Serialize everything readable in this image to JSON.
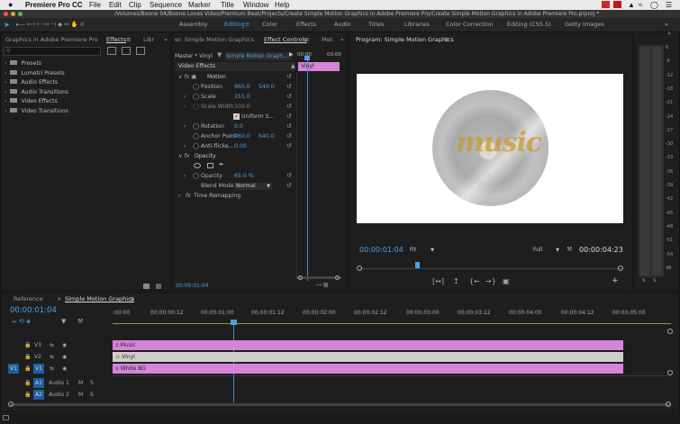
{
  "menubar": {
    "apple": "",
    "app": "Premiere Pro CC",
    "items": [
      "File",
      "Edit",
      "Clip",
      "Sequence",
      "Marker",
      "Title",
      "Window",
      "Help"
    ]
  },
  "titlebar": {
    "path": "/Volumes/Boone 04/Boone Loves Video/Premium Beat/Projects/Create Simple Motion Graphics in Adobe Premiere Pro/Create Simple Motion Graphics in Adobe Premiere Pro.prproj *"
  },
  "workspaces": [
    "Assembly",
    "Editing",
    "Color",
    "Effects",
    "Audio",
    "Titles",
    "Libraries",
    "Color Correction",
    "Editing (CS5.5)",
    "Getty Images"
  ],
  "active_workspace": "Editing",
  "project_panel": {
    "tab_title": "Graphics in Adobe Premiere Pro",
    "tab_effects": "Effects",
    "tab_lib": "Libr",
    "search_placeholder": "",
    "tree": [
      "Presets",
      "Lumetri Presets",
      "Audio Effects",
      "Audio Transitions",
      "Video Effects",
      "Video Transitions"
    ]
  },
  "effect_controls": {
    "tab_source": "er: Simple Motion Graphics",
    "tab_ec": "Effect Controls",
    "tab_meta": "Met",
    "master": "Master * Vinyl",
    "sequence": "Simple Motion Graph...",
    "header": "Video Effects",
    "mini_time_start": "00:00",
    "mini_time_end": "00:00",
    "clip_label": "Vinyl",
    "motion": "Motion",
    "position": "Position",
    "position_x": "960.0",
    "position_y": "540.0",
    "scale": "Scale",
    "scale_val": "151.0",
    "scale_width": "Scale Width",
    "scale_width_val": "100.0",
    "uniform": "Uniform S...",
    "rotation": "Rotation",
    "rotation_val": "0.0",
    "anchor": "Anchor Point",
    "anchor_x": "960.0",
    "anchor_y": "540.0",
    "antiflicker": "Anti-flicke...",
    "antiflicker_val": "0.00",
    "opacity_group": "Opacity",
    "opacity": "Opacity",
    "opacity_val": "65.0 %",
    "blend": "Blend Mode",
    "blend_val": "Normal",
    "time_remap": "Time Remapping",
    "timecode": "00:00:01:04"
  },
  "program": {
    "title": "Program: Simple Motion Graphics",
    "timecode": "00:00:01:04",
    "fit": "Fit",
    "quality": "Full",
    "duration": "00:00:04:23",
    "graphic_text": "music"
  },
  "meter": {
    "scale": [
      "0",
      "-6",
      "-12",
      "-18",
      "-21",
      "-24",
      "-27",
      "-30",
      "-33",
      "-36",
      "-39",
      "-42",
      "-45",
      "-48",
      "-51",
      "-54",
      "dB"
    ],
    "foot": [
      "S",
      "S"
    ]
  },
  "timeline": {
    "tab_ref": "Reference",
    "tab_seq": "Simple Motion Graphics",
    "timecode": "00:00:01:04",
    "ruler": [
      ":00:00",
      "00:00:00:12",
      "00:00:01:00",
      "00:00:01:12",
      "00:00:02:00",
      "00:00:02:12",
      "00:00:03:00",
      "00:00:03:12",
      "00:00:04:00",
      "00:00:04:12",
      "00:00:05:00"
    ],
    "tracks": [
      {
        "id": "V3",
        "label": "V3",
        "clip": "Music"
      },
      {
        "id": "V2",
        "label": "V2",
        "clip": "Vinyl"
      },
      {
        "id": "V1",
        "label": "V1",
        "clip": "White BG"
      },
      {
        "id": "A1",
        "label": "A1",
        "name": "Audio 1",
        "m": "M",
        "s": "S"
      },
      {
        "id": "A2",
        "label": "A2",
        "name": "Audio 2",
        "m": "M",
        "s": "S"
      }
    ],
    "src_v": "V1"
  },
  "colors": {
    "accent": "#4aa3e6",
    "clip": "#d584d8",
    "disc": "#b1b1b1",
    "text": "#c89b2e"
  }
}
